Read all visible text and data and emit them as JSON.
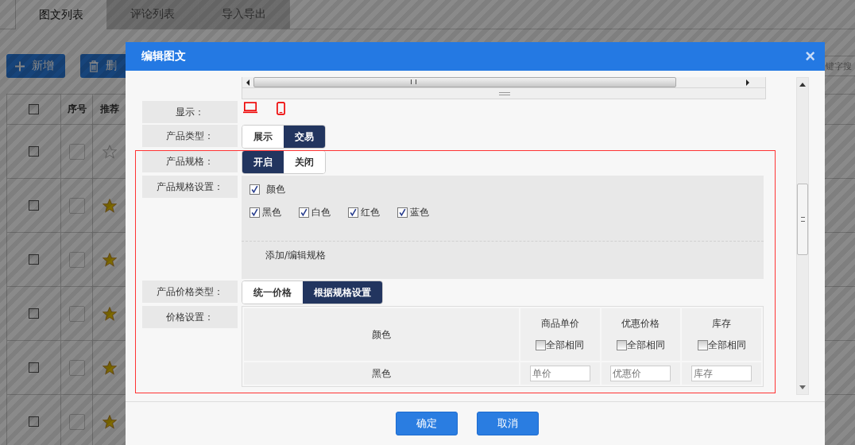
{
  "background": {
    "tabs": [
      {
        "label": "图文列表",
        "selected": true
      },
      {
        "label": "评论列表",
        "selected": false
      },
      {
        "label": "导入导出",
        "selected": false
      }
    ],
    "toolbar": {
      "buttons": [
        {
          "label": "新增",
          "kind": "add"
        },
        {
          "label": "删",
          "kind": "delete"
        }
      ],
      "search": {
        "placeholder": "键字搜"
      }
    },
    "table": {
      "select_all": {
        "checked": false
      },
      "columns": [
        "序号",
        "推荐"
      ],
      "rows": [
        {
          "checked": false,
          "starred": false
        },
        {
          "checked": false,
          "starred": true
        },
        {
          "checked": false,
          "starred": true
        },
        {
          "checked": false,
          "starred": true
        },
        {
          "checked": false,
          "starred": true
        },
        {
          "checked": false,
          "starred": true
        }
      ]
    }
  },
  "dialog": {
    "title": "编辑图文",
    "close": "×",
    "fields": [
      {
        "kind": "display",
        "label": "显示："
      },
      {
        "kind": "segmented",
        "label": "产品类型：",
        "options": [
          {
            "label": "展示",
            "selected": false
          },
          {
            "label": "交易",
            "selected": true
          }
        ]
      },
      {
        "kind": "segmented",
        "label": "产品规格：",
        "options": [
          {
            "label": "开启",
            "selected": true
          },
          {
            "label": "关闭",
            "selected": false
          }
        ]
      },
      {
        "kind": "spec",
        "label": "产品规格设置：",
        "groups": [
          {
            "name": "颜色",
            "checked": true,
            "values": [
              {
                "label": "黑色",
                "checked": true
              },
              {
                "label": "白色",
                "checked": true
              },
              {
                "label": "红色",
                "checked": true
              },
              {
                "label": "蓝色",
                "checked": true
              }
            ]
          }
        ],
        "link": "添加/编辑规格"
      },
      {
        "kind": "segmented",
        "label": "产品价格类型：",
        "options": [
          {
            "label": "统一价格",
            "selected": false
          },
          {
            "label": "根据规格设置",
            "selected": true
          }
        ]
      },
      {
        "kind": "price_table",
        "label": "价格设置：",
        "first_column": "颜色",
        "columns": [
          {
            "label": "商品单价",
            "same_label": "全部相同",
            "same_checked": false
          },
          {
            "label": "优惠价格",
            "same_label": "全部相同",
            "same_checked": false
          },
          {
            "label": "库存",
            "same_label": "全部相同",
            "same_checked": false
          }
        ],
        "rows": [
          {
            "name": "黑色",
            "placeholders": [
              "单价",
              "优惠价",
              "库存"
            ]
          }
        ]
      }
    ],
    "buttons": [
      {
        "label": "确定"
      },
      {
        "label": "取消"
      }
    ]
  }
}
